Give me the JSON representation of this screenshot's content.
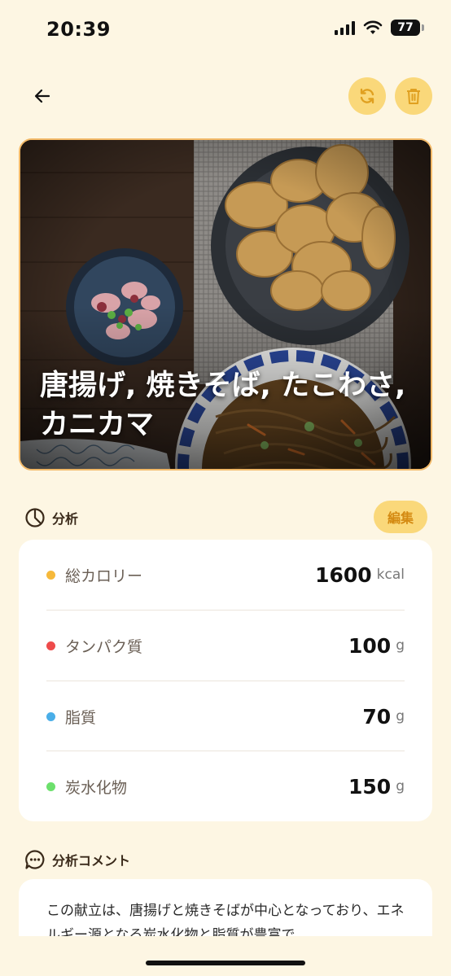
{
  "status": {
    "time": "20:39",
    "battery": "77"
  },
  "header": {
    "back_icon": "arrow-left-icon",
    "refresh_icon": "refresh-icon",
    "trash_icon": "trash-icon"
  },
  "hero": {
    "title": "唐揚げ, 焼きそば, たこわさ, カニカマ"
  },
  "analysis": {
    "label": "分析",
    "edit_label": "編集",
    "items": [
      {
        "name": "総カロリー",
        "value": "1600",
        "unit": "kcal",
        "color": "#f6b93b"
      },
      {
        "name": "タンパク質",
        "value": "100",
        "unit": "g",
        "color": "#ee4b4b"
      },
      {
        "name": "脂質",
        "value": "70",
        "unit": "g",
        "color": "#4aaee8"
      },
      {
        "name": "炭水化物",
        "value": "150",
        "unit": "g",
        "color": "#6ce06c"
      }
    ]
  },
  "comment": {
    "label": "分析コメント",
    "text": "この献立は、唐揚げと焼きそばが中心となっており、エネルギー源となる炭水化物と脂質が豊富で"
  }
}
